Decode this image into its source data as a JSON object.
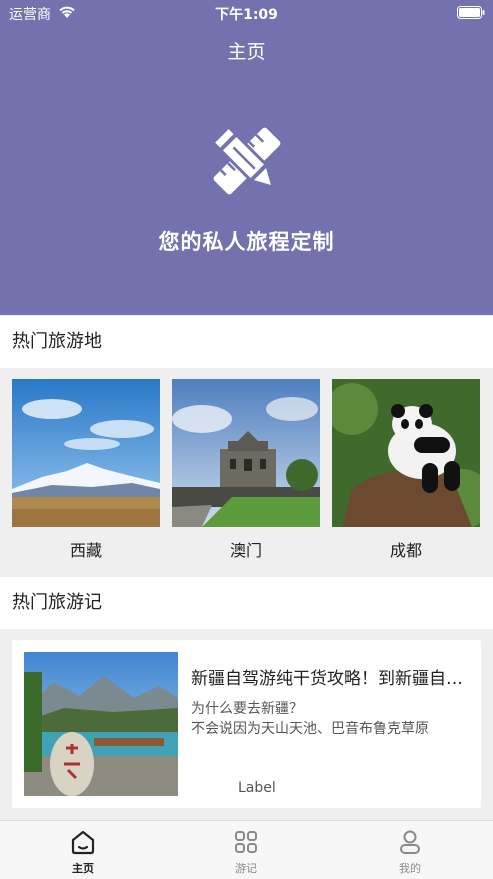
{
  "status_bar": {
    "carrier": "运营商",
    "time": "下午1:09"
  },
  "header": {
    "title": "主页",
    "slogan": "您的私人旅程定制"
  },
  "hot_destinations": {
    "heading": "热门旅游地",
    "items": [
      {
        "name": "西藏",
        "image": "snow-mountain-photo"
      },
      {
        "name": "澳门",
        "image": "ruins-of-st-paul-photo"
      },
      {
        "name": "成都",
        "image": "panda-photo"
      }
    ]
  },
  "hot_notes": {
    "heading": "热门旅游记",
    "items": [
      {
        "title": "新疆自驾游纯干货攻略！到新疆自驾游必看",
        "desc_line1": "为什么要去新疆？",
        "desc_line2": "不会说因为天山天池、巴音布鲁克草原",
        "label": "Label",
        "image": "tianchi-lake-photo"
      }
    ]
  },
  "tabbar": {
    "tabs": [
      {
        "label": "主页",
        "icon": "home-icon",
        "active": true
      },
      {
        "label": "游记",
        "icon": "grid-icon",
        "active": false
      },
      {
        "label": "我的",
        "icon": "person-icon",
        "active": false
      }
    ]
  },
  "colors": {
    "header_bg": "#7472ae",
    "page_bg": "#efefef"
  }
}
